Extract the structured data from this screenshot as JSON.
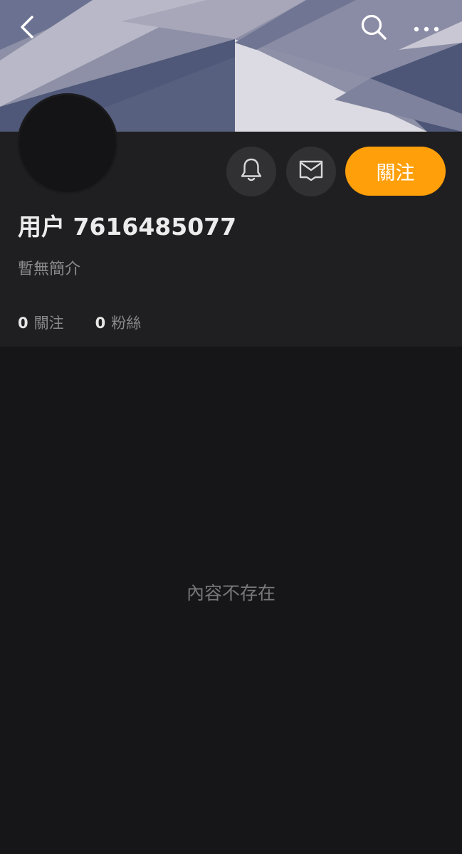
{
  "profile": {
    "username": "用户 7616485077",
    "bio": "暫無簡介",
    "follow_button": "關注"
  },
  "stats": {
    "following_count": "0",
    "following_label": "關注",
    "followers_count": "0",
    "followers_label": "粉絲"
  },
  "content": {
    "empty_message": "內容不存在"
  },
  "icons": {
    "back": "chevron-left-icon",
    "search": "search-icon",
    "more": "more-horizontal-icon",
    "bell": "bell-icon",
    "message": "message-icon"
  },
  "colors": {
    "accent": "#ff9f0a",
    "background": "#161618",
    "panel": "#1f1f21"
  }
}
